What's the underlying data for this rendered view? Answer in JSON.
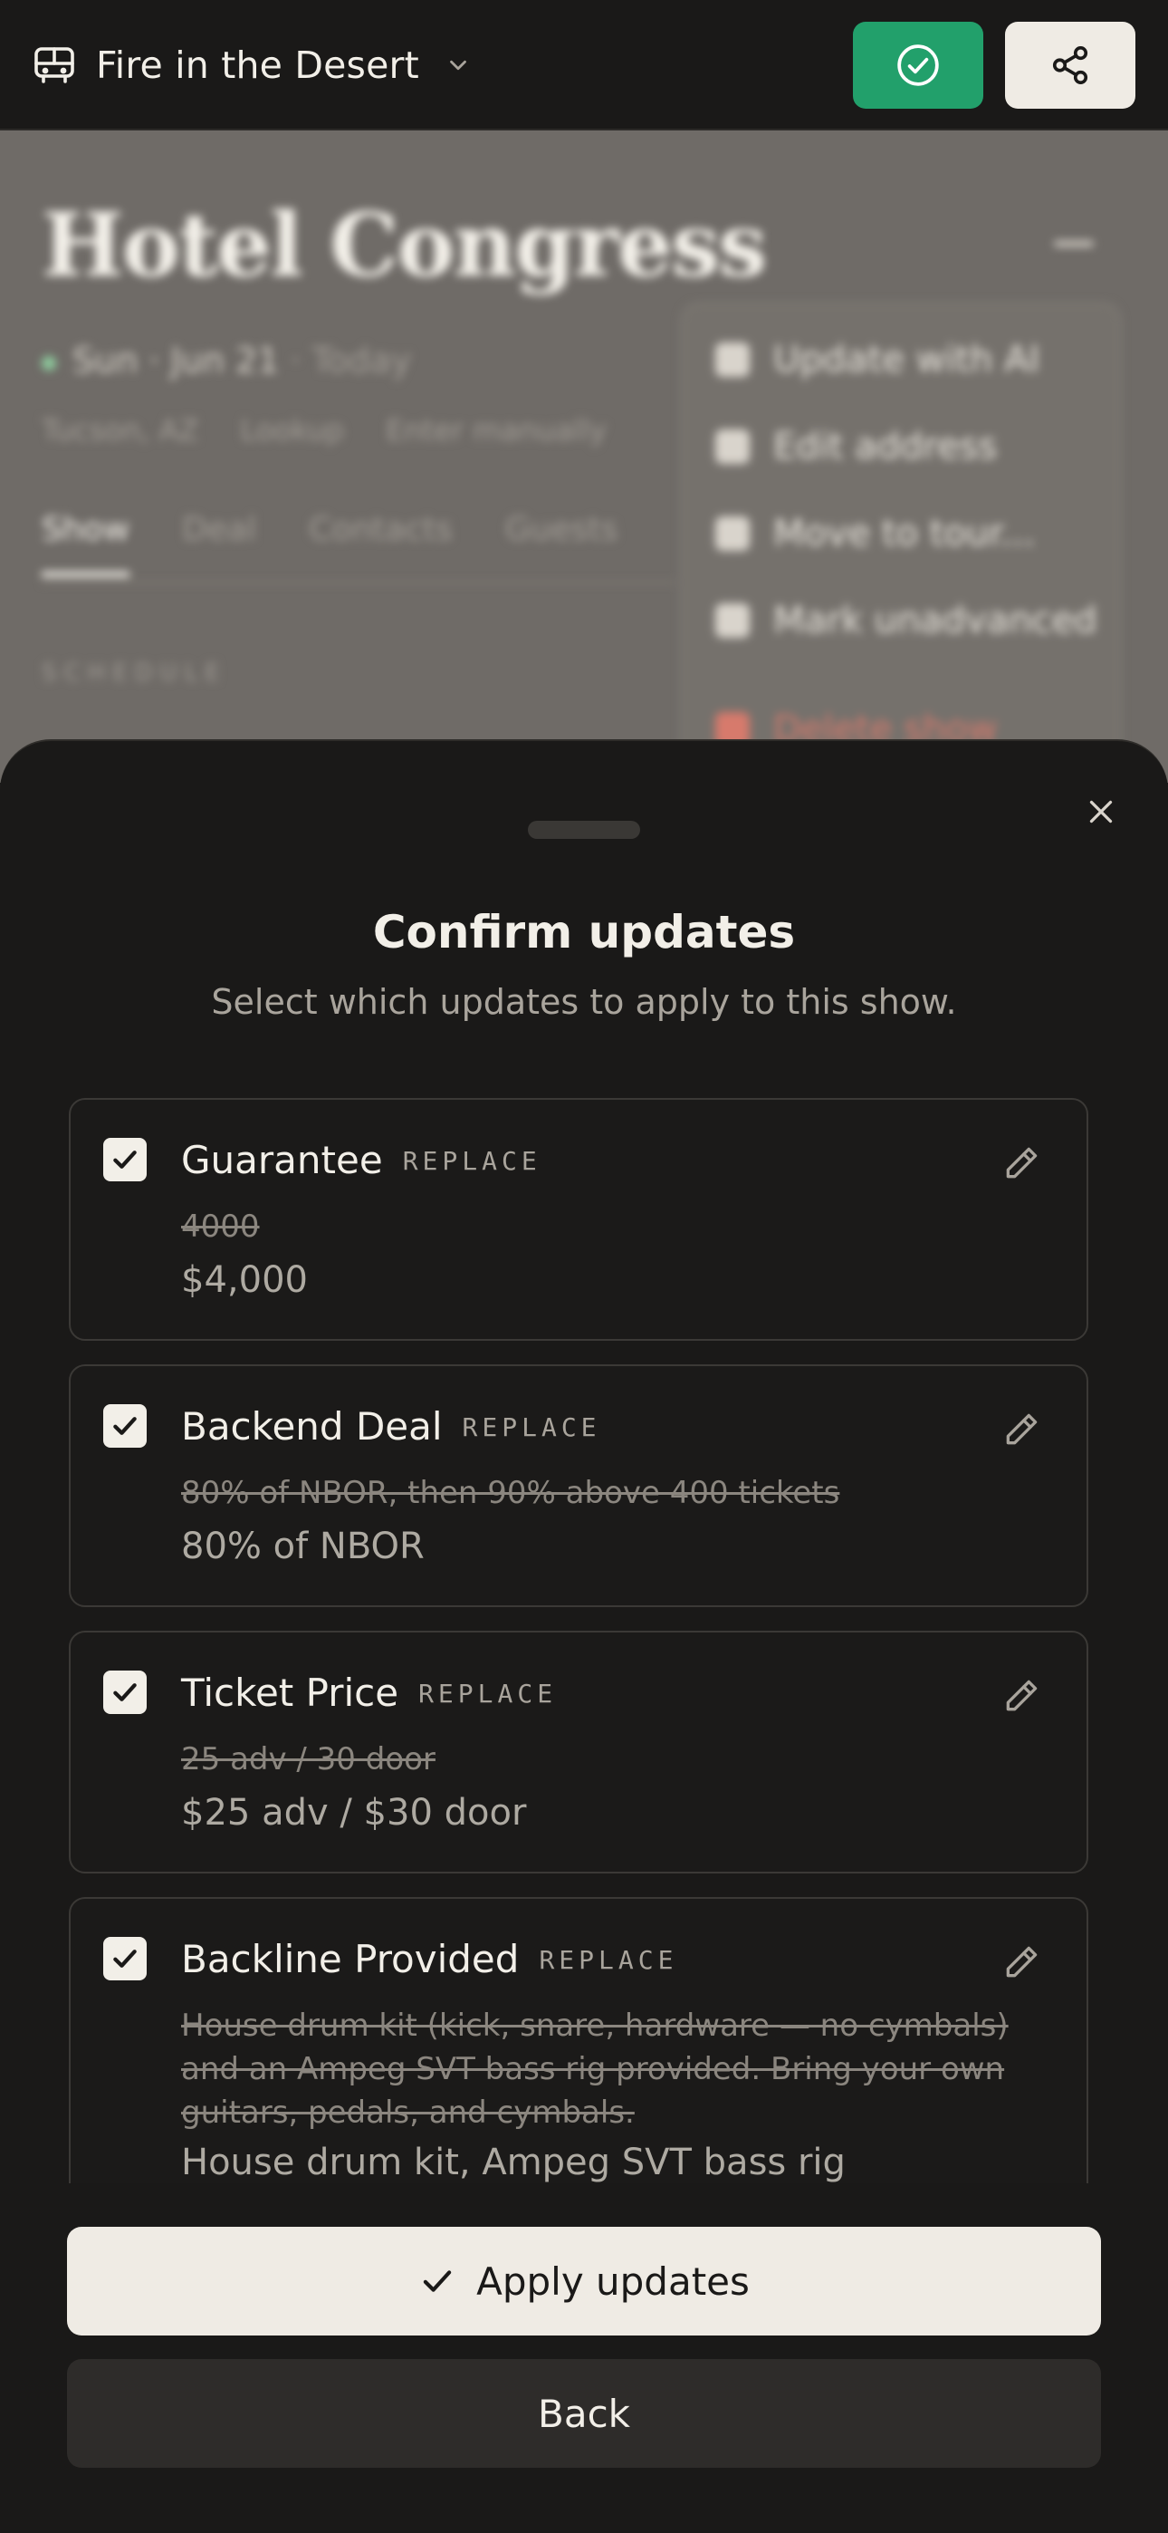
{
  "header": {
    "tour_name": "Fire in the Desert",
    "icons": {
      "tour": "bus-icon",
      "dropdown": "chevron-down-icon",
      "confirm": "check-circle-icon",
      "share": "share-icon"
    },
    "colors": {
      "confirm_bg": "#22a06b",
      "share_bg": "#efebe4"
    }
  },
  "background": {
    "venue": "Hotel Congress",
    "date": "Sun · Jun 21",
    "date_hint": "· Today",
    "location": "Tucson, AZ",
    "location_actions": [
      "Lookup",
      "Enter manually"
    ],
    "tabs": [
      "Show",
      "Deal",
      "Contacts",
      "Guests"
    ],
    "active_tab": "Show",
    "section": "SCHEDULE",
    "menu": [
      "Update with AI",
      "Edit address",
      "Move to tour...",
      "Mark unadvanced",
      "Delete show"
    ]
  },
  "sheet": {
    "title": "Confirm updates",
    "subtitle": "Select which updates to apply to this show.",
    "updates": [
      {
        "field": "Guarantee",
        "action": "REPLACE",
        "old": "4000",
        "new": "$4,000",
        "checked": true
      },
      {
        "field": "Backend Deal",
        "action": "REPLACE",
        "old": "80% of NBOR, then 90% above 400 tickets",
        "new": "80% of NBOR",
        "checked": true
      },
      {
        "field": "Ticket Price",
        "action": "REPLACE",
        "old": "25 adv / 30 door",
        "new": "$25 adv / $30 door",
        "checked": true
      },
      {
        "field": "Backline Provided",
        "action": "REPLACE",
        "old": "House drum kit (kick, snare, hardware — no cymbals) and an Ampeg SVT bass rig provided. Bring your own guitars, pedals, and cymbals.",
        "new": "House drum kit, Ampeg SVT bass rig",
        "checked": true
      }
    ],
    "apply_label": "Apply updates",
    "back_label": "Back"
  }
}
